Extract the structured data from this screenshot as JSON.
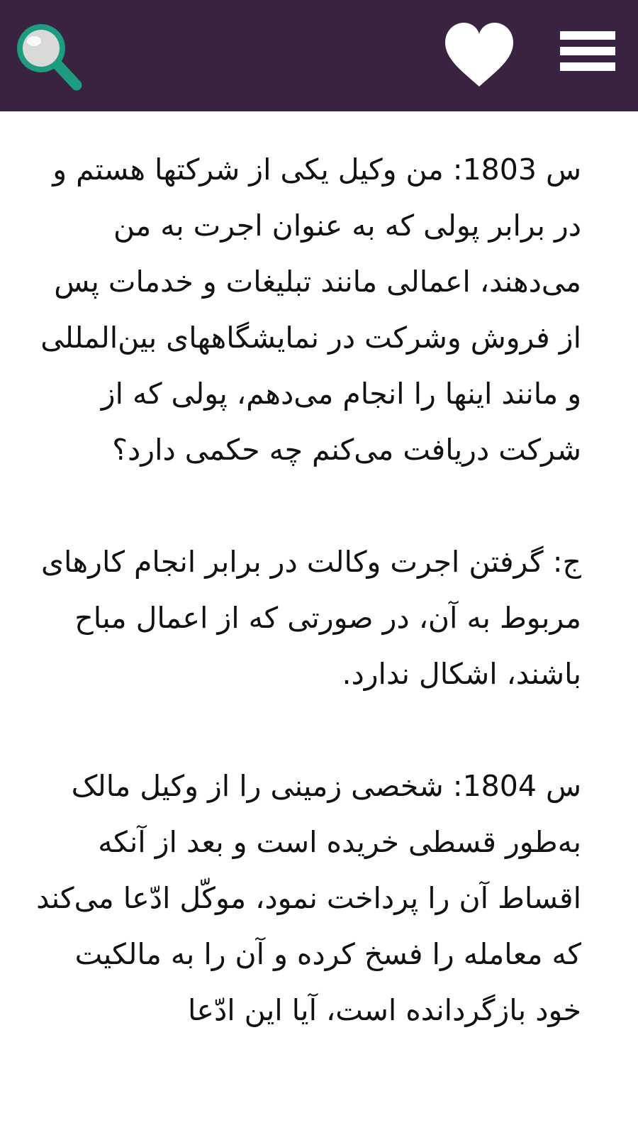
{
  "header": {
    "background_color": "#3a2340",
    "icons": {
      "search": "search-icon",
      "favorite": "heart-icon",
      "menu": "menu-icon"
    },
    "colors": {
      "search_ring": "#1e9c7f",
      "icon_white": "#ffffff"
    }
  },
  "content": {
    "paragraphs": [
      "س 1803: من وکیل یکی از شرکتها هستم و در برابر پولی که به عنوان اجرت به من می‌دهند، اعمالی مانند تبلیغات و خدمات پس از فروش وشرکت در نمایشگاههای بین‌المللی و مانند اینها را انجام می‌دهم، پولی که از شرکت دریافت می‌کنم چه حکمی دارد؟",
      "ج: گرفتن اجرت وکالت در برابر انجام کارهای مربوط به آن، در صورتی که از اعمال مباح باشند، اشکال ندارد.",
      "س 1804: شخصی زمینی را از وکیل مالک به‌طور قسطی خریده است و بعد از آنکه اقساط آن را پرداخت نمود، موکّل ادّعا می‌کند که معامله را فسخ کرده و آن را به مالکیت خود بازگردانده است، آیا این ادّعا"
    ]
  }
}
